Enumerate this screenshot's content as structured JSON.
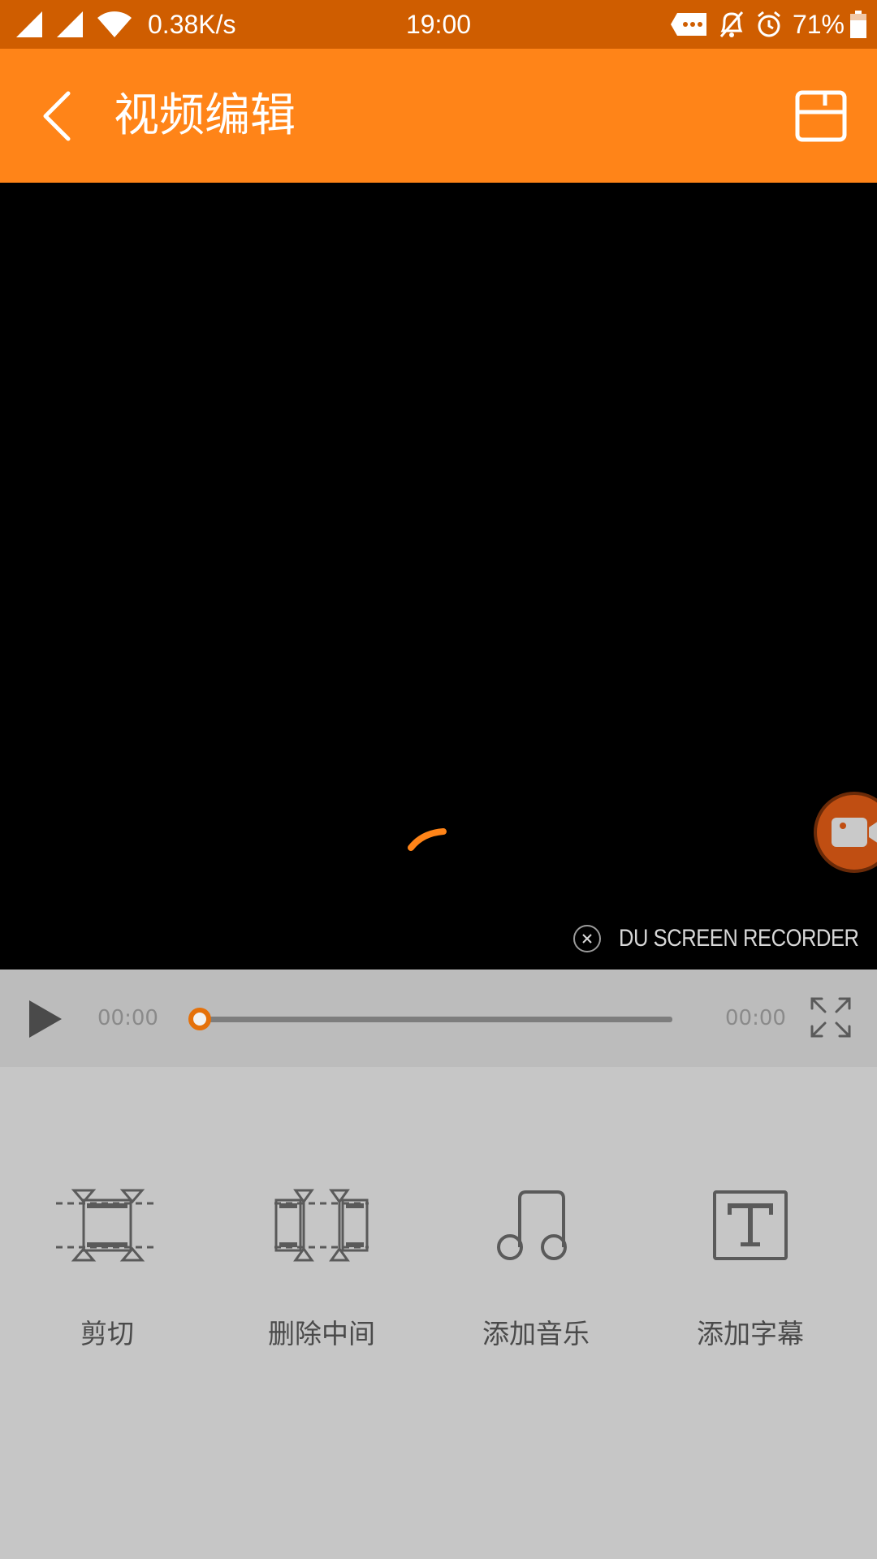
{
  "status_bar": {
    "net_speed": "0.38K/s",
    "time": "19:00",
    "battery": "71%"
  },
  "toolbar": {
    "title": "视频编辑",
    "back_icon": "chevron-left-icon",
    "save_icon": "save-icon"
  },
  "watermark": {
    "label": "DU SCREEN RECORDER"
  },
  "player": {
    "current_time": "00:00",
    "total_time": "00:00",
    "progress": 0
  },
  "tools": [
    {
      "label": "剪切",
      "icon": "trim-icon"
    },
    {
      "label": "删除中间",
      "icon": "delete-middle-icon"
    },
    {
      "label": "添加音乐",
      "icon": "music-note-icon"
    },
    {
      "label": "添加字幕",
      "icon": "text-icon"
    }
  ],
  "colors": {
    "status_bar": "#cf5d00",
    "toolbar": "#ff8418",
    "accent": "#e5710a",
    "panel": "#c6c6c6"
  }
}
